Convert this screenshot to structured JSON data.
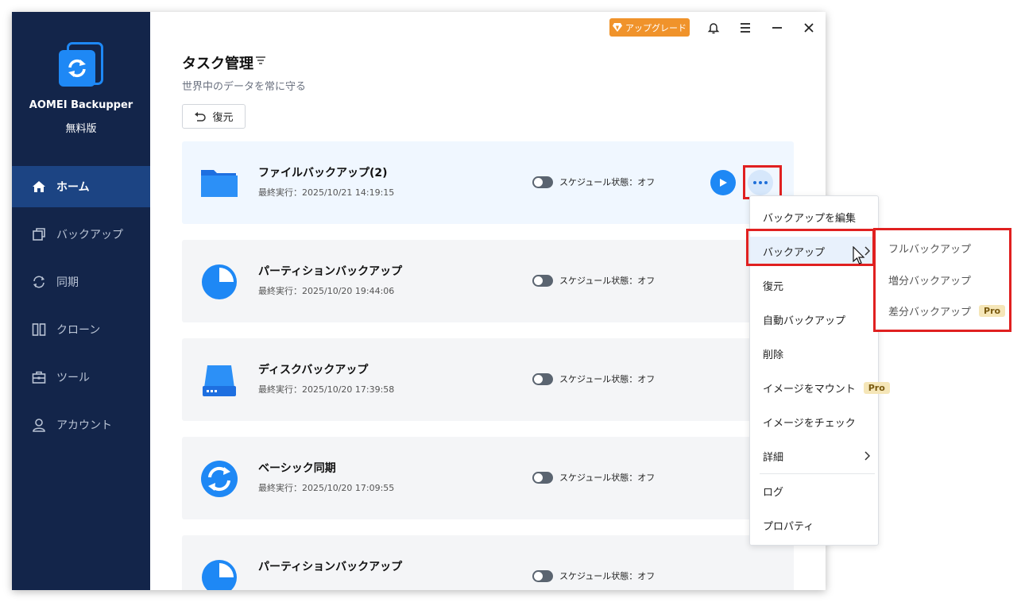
{
  "app": {
    "name": "AOMEI Backupper",
    "edition": "無料版",
    "upgrade_label": "アップグレード"
  },
  "colors": {
    "sidebar_bg": "#13254a",
    "sidebar_active": "#1c4483",
    "accent": "#1e88f5",
    "upgrade": "#f0932b",
    "highlight_box": "#e02020"
  },
  "sidebar": {
    "items": [
      {
        "label": "ホーム",
        "icon": "home-icon",
        "active": true
      },
      {
        "label": "バックアップ",
        "icon": "backup-icon",
        "active": false
      },
      {
        "label": "同期",
        "icon": "sync-icon",
        "active": false
      },
      {
        "label": "クローン",
        "icon": "clone-icon",
        "active": false
      },
      {
        "label": "ツール",
        "icon": "toolbox-icon",
        "active": false
      },
      {
        "label": "アカウント",
        "icon": "user-icon",
        "active": false
      }
    ]
  },
  "titlebar": {
    "icons": [
      "bell-icon",
      "menu-icon",
      "minimize-icon",
      "close-icon"
    ]
  },
  "header": {
    "title": "タスク管理",
    "subtitle": "世界中のデータを常に守る",
    "restore_label": "復元"
  },
  "tasks": [
    {
      "name": "ファイルバックアップ(2)",
      "last_run": "最終実行：2025/10/21 14:19:15",
      "schedule": "スケジュール状態：オフ",
      "icon": "folder-icon",
      "schedule_on": false
    },
    {
      "name": "パーティションバックアップ",
      "last_run": "最終実行：2025/10/20 19:44:06",
      "schedule": "スケジュール状態：オフ",
      "icon": "partition-icon",
      "schedule_on": false
    },
    {
      "name": "ディスクバックアップ",
      "last_run": "最終実行：2025/10/20 17:39:58",
      "schedule": "スケジュール状態：オフ",
      "icon": "disk-icon",
      "schedule_on": false
    },
    {
      "name": "ベーシック同期",
      "last_run": "最終実行：2025/10/20 17:09:55",
      "schedule": "スケジュール状態：オフ",
      "icon": "sync-circle-icon",
      "schedule_on": false
    },
    {
      "name": "パーティションバックアップ",
      "last_run": "",
      "schedule": "スケジュール状態：オフ",
      "icon": "partition-icon",
      "schedule_on": false
    }
  ],
  "context_menu": {
    "items": [
      {
        "label": "バックアップを編集"
      },
      {
        "label": "バックアップ",
        "has_submenu": true,
        "hover": true
      },
      {
        "label": "復元"
      },
      {
        "label": "自動バックアップ"
      },
      {
        "label": "削除"
      },
      {
        "label": "イメージをマウント",
        "badge": "Pro"
      },
      {
        "label": "イメージをチェック"
      },
      {
        "label": "詳細",
        "has_submenu": true
      },
      {
        "label": "ログ"
      },
      {
        "label": "プロパティ"
      }
    ]
  },
  "submenu": {
    "items": [
      {
        "label": "フルバックアップ"
      },
      {
        "label": "増分バックアップ"
      },
      {
        "label": "差分バックアップ",
        "badge": "Pro"
      }
    ]
  }
}
